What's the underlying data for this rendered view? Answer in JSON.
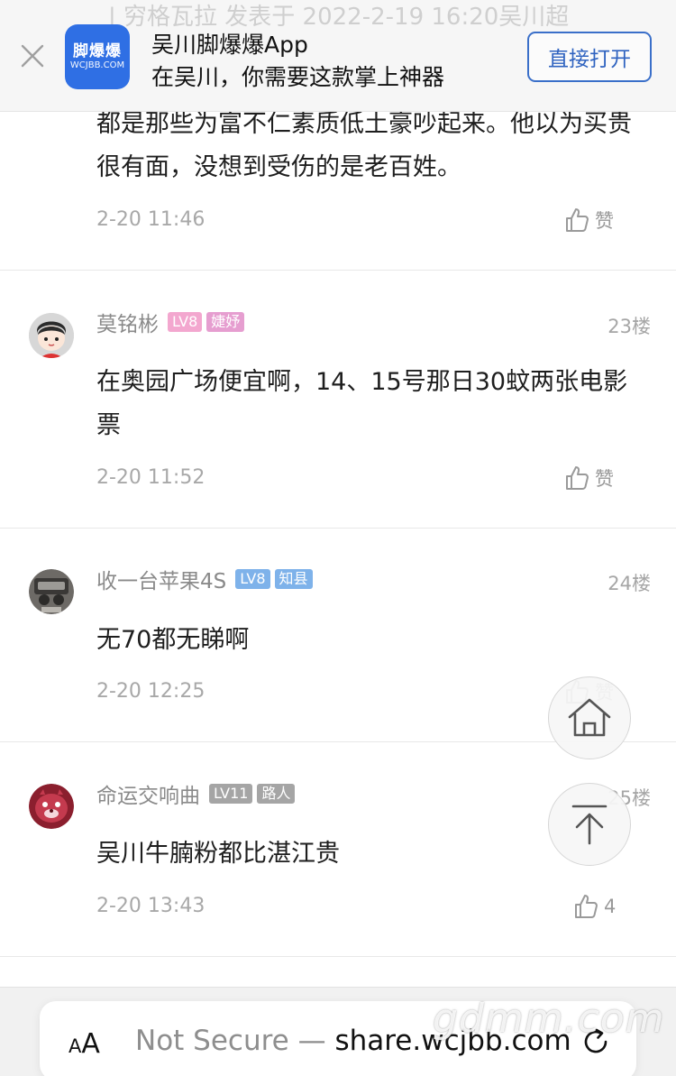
{
  "banner": {
    "ghost_text": "| 穷格瓦拉 发表于 2022-2-19 16:20吴川超",
    "logo_main": "脚爆爆",
    "logo_sub": "WCJBB.COM",
    "title": "吴川脚爆爆App",
    "subtitle": "在吴川，你需要这款掌上神器",
    "open_label": "直接打开"
  },
  "comments": [
    {
      "text": "都是那些为富不仁素质低土豪吵起来。他以为买贵很有面，没想到受伤的是老百姓。",
      "time": "2-20 11:46",
      "like_label": "赞"
    },
    {
      "user": "莫铭彬",
      "level": "LV8",
      "role": "婕妤",
      "floor": "23楼",
      "text": "在奥园广场便宜啊，14、15号那日30蚊两张电影票",
      "time": "2-20 11:52",
      "like_label": "赞"
    },
    {
      "user": "收一台苹果4S",
      "level": "LV8",
      "role": "知县",
      "floor": "24楼",
      "text": "无70都无睇啊",
      "time": "2-20 12:25",
      "like_label": "赞"
    },
    {
      "user": "命运交响曲",
      "level": "LV11",
      "role": "路人",
      "floor": "25楼",
      "text": "吴川牛腩粉都比湛江贵",
      "time": "2-20 13:43",
      "like_label": "4"
    }
  ],
  "browser": {
    "aa_label_small": "A",
    "aa_label_big": "A",
    "security_label": "Not Secure — ",
    "domain": "share.wcjbb.com"
  },
  "watermark": "gdmm.com",
  "colors": {
    "accent": "#2f63c0",
    "logo_bg": "#2f6fe4",
    "badge_pink": "#f3a7cf",
    "badge_blue": "#7eb2ea",
    "badge_gray": "#a5a5a5"
  },
  "icons": [
    "close-icon",
    "thumbs-up-icon",
    "home-icon",
    "back-to-top-icon",
    "reload-icon"
  ]
}
